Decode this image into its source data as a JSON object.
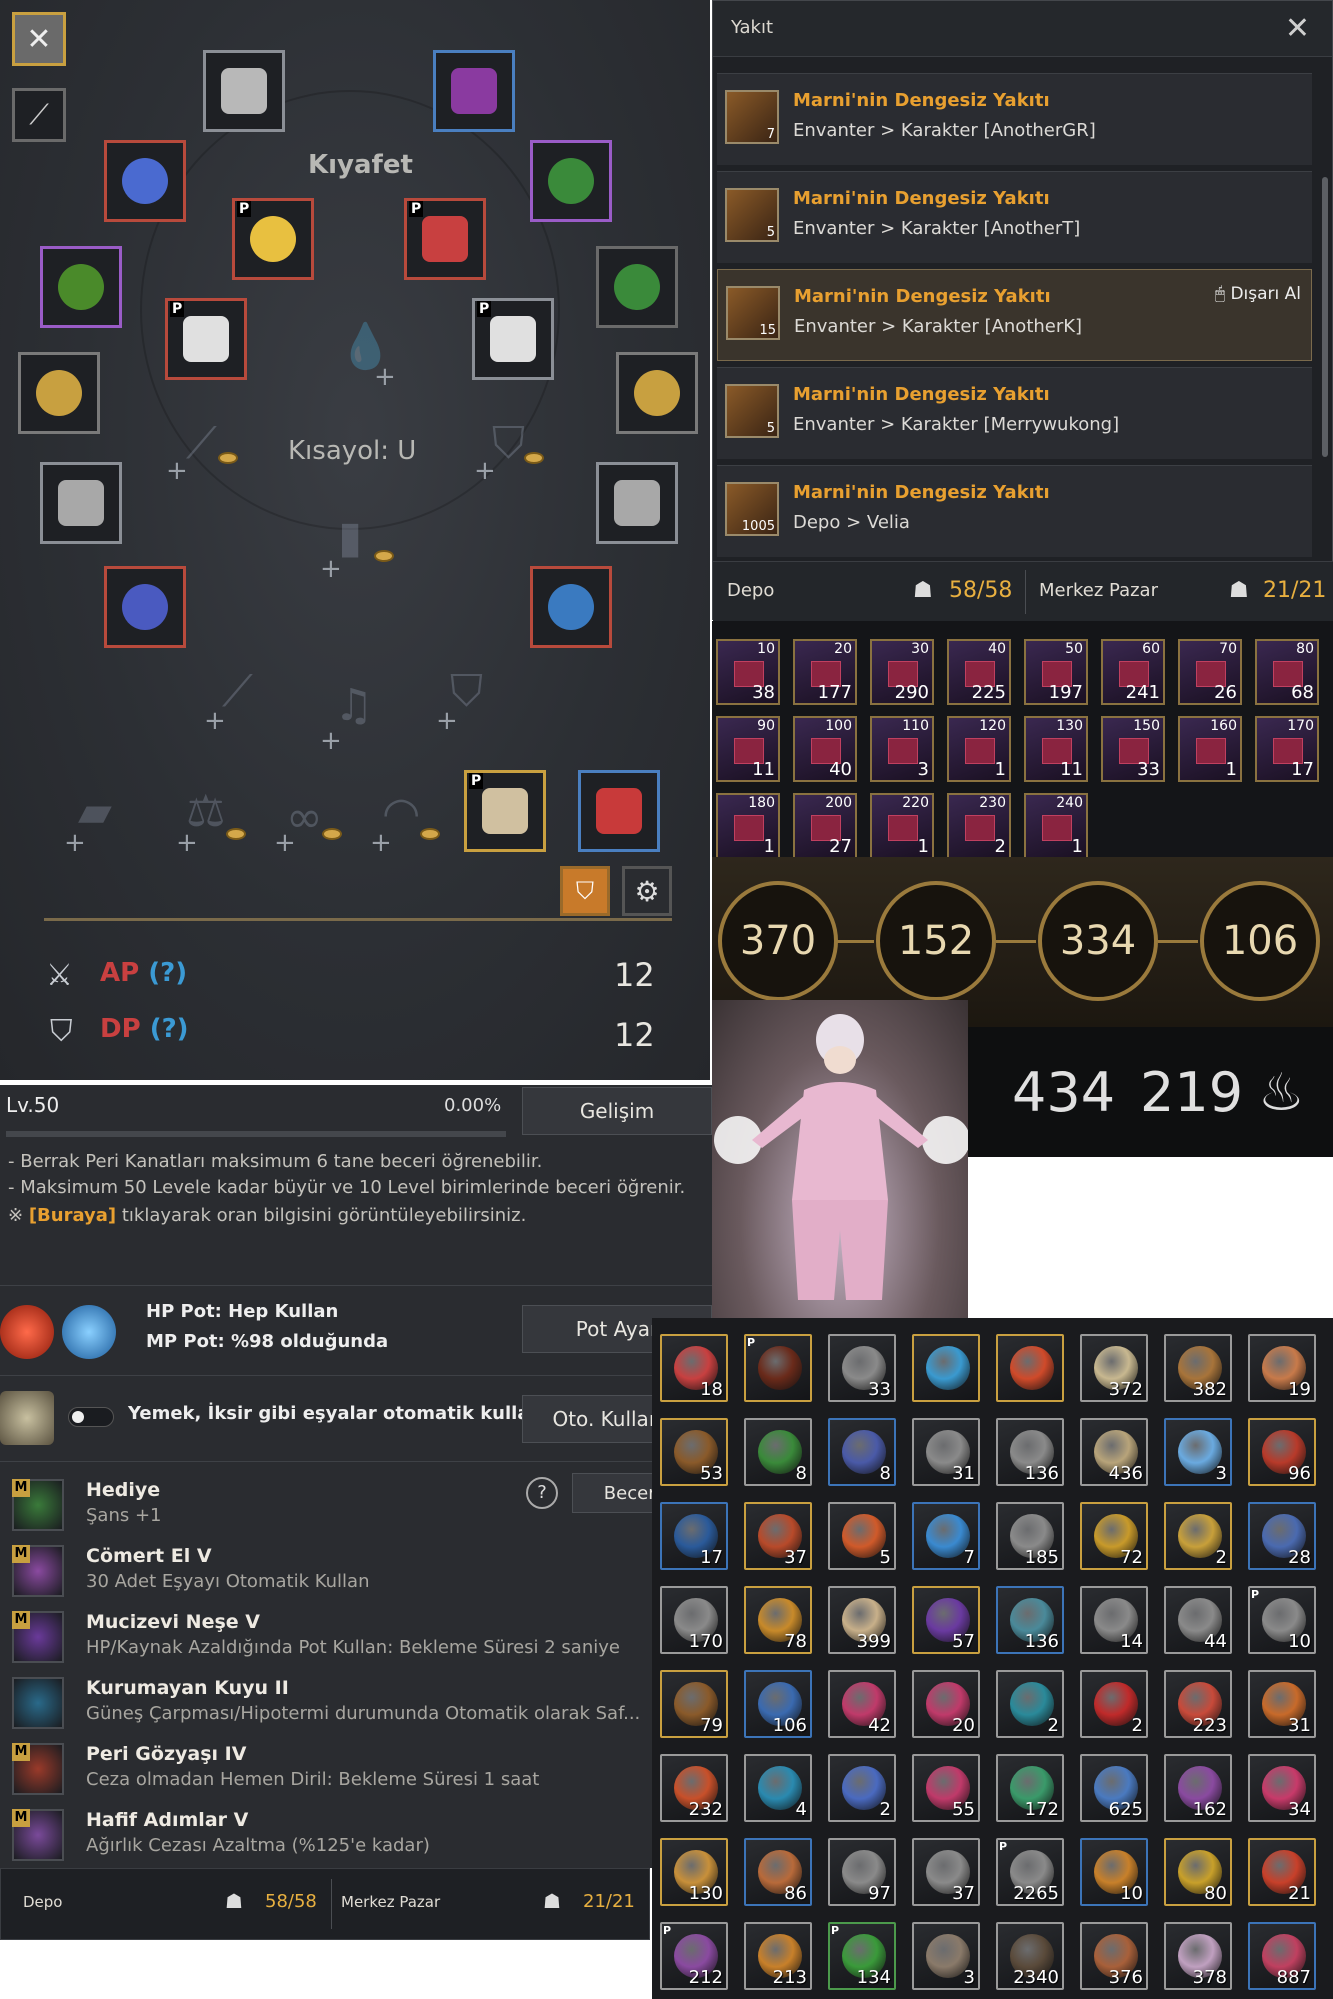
{
  "equipment": {
    "title": "Kıyafet",
    "shortcut": "Kısayol: U",
    "ap_label": "AP",
    "dp_label": "DP",
    "help_mark": "(?)",
    "ap_value": "12",
    "dp_value": "12",
    "premium_mark": "P",
    "colors": {
      "accent_gold": "#d4a84a",
      "rare_red": "#b84a3c",
      "epic_purple": "#9a5cc7",
      "blue": "#4a7fc0"
    }
  },
  "fuel": {
    "title": "Yakıt",
    "take_out": "Dışarı Al",
    "items": [
      {
        "name": "Marni'nin Dengesiz Yakıtı",
        "location": "Envanter > Karakter [AnotherGR]",
        "count": "7"
      },
      {
        "name": "Marni'nin Dengesiz Yakıtı",
        "location": "Envanter > Karakter [AnotherT]",
        "count": "5"
      },
      {
        "name": "Marni'nin Dengesiz Yakıtı",
        "location": "Envanter > Karakter [AnotherK]",
        "count": "15"
      },
      {
        "name": "Marni'nin Dengesiz Yakıtı",
        "location": "Envanter > Karakter [Merrywukong]",
        "count": "5"
      },
      {
        "name": "Marni'nin Dengesiz Yakıtı",
        "location": "Depo > Velia",
        "count": "1005"
      }
    ],
    "storage_label": "Depo",
    "storage_value": "58/58",
    "market_label": "Merkez Pazar",
    "market_value": "21/21"
  },
  "books": [
    {
      "level": "10",
      "count": "38"
    },
    {
      "level": "20",
      "count": "177"
    },
    {
      "level": "30",
      "count": "290"
    },
    {
      "level": "40",
      "count": "225"
    },
    {
      "level": "50",
      "count": "197"
    },
    {
      "level": "60",
      "count": "241"
    },
    {
      "level": "70",
      "count": "26"
    },
    {
      "level": "80",
      "count": "68"
    },
    {
      "level": "90",
      "count": "11"
    },
    {
      "level": "100",
      "count": "40"
    },
    {
      "level": "110",
      "count": "3"
    },
    {
      "level": "120",
      "count": "1"
    },
    {
      "level": "130",
      "count": "11"
    },
    {
      "level": "150",
      "count": "33"
    },
    {
      "level": "160",
      "count": "1"
    },
    {
      "level": "170",
      "count": "17"
    },
    {
      "level": "180",
      "count": "1"
    },
    {
      "level": "200",
      "count": "27"
    },
    {
      "level": "220",
      "count": "1"
    },
    {
      "level": "230",
      "count": "2"
    },
    {
      "level": "240",
      "count": "1"
    }
  ],
  "circles": [
    "370",
    "152",
    "334",
    "106"
  ],
  "strip": {
    "value1": "434",
    "value2": "219"
  },
  "skills_panel": {
    "level": "Lv.50",
    "xp_percent": "0.00%",
    "xp_fraction": 0.0,
    "growth_button": "Gelişim",
    "info_lines": [
      "- Berrak Peri Kanatları maksimum 6 tane beceri öğrenebilir.",
      "- Maksimum 50 Levele kadar büyür ve 10 Level birimlerinde beceri öğrenir."
    ],
    "info_note_prefix": "※ ",
    "info_link": "[Buraya]",
    "info_note_suffix": " tıklayarak oran bilgisini görüntüleyebilirsiniz.",
    "hp_pot": "HP Pot: Hep Kullan",
    "mp_pot": "MP Pot: %98 olduğunda",
    "pot_button": "Pot Ayar",
    "auto_use_text": "Yemek, İksir gibi eşyalar otomatik kullanılır.",
    "auto_use_button": "Oto. Kullan A",
    "skill_button": "Beceri D",
    "help_symbol": "?",
    "skills": [
      {
        "name": "Hediye",
        "desc": "Şans +1",
        "mark": "M"
      },
      {
        "name": "Cömert El V",
        "desc": "30 Adet Eşyayı Otomatik Kullan",
        "mark": "M"
      },
      {
        "name": "Mucizevi Neşe V",
        "desc": "HP/Kaynak Azaldığında Pot Kullan: Bekleme Süresi 2 saniye",
        "mark": "M"
      },
      {
        "name": "Kurumayan Kuyu II",
        "desc": "Güneş Çarpması/Hipotermi durumunda Otomatik olarak Saf...",
        "mark": ""
      },
      {
        "name": "Peri Gözyaşı IV",
        "desc": "Ceza olmadan Hemen Diril: Bekleme Süresi 1 saat",
        "mark": "M"
      },
      {
        "name": "Hafif Adımlar V",
        "desc": "Ağırlık Cezası Azaltma (%125'e kadar)",
        "mark": "M"
      }
    ]
  },
  "bottom_bar": {
    "storage_label": "Depo",
    "storage_value": "58/58",
    "market_label": "Merkez Pazar",
    "market_value": "21/21"
  },
  "inventory": [
    {
      "count": "18",
      "c": "#c84040",
      "b": "g"
    },
    {
      "count": "",
      "c": "#6a2a1a",
      "b": "g",
      "p": "P"
    },
    {
      "count": "33",
      "c": "#8a8a8a",
      "b": "w"
    },
    {
      "count": "",
      "c": "#3a9ad0",
      "b": "g"
    },
    {
      "count": "",
      "c": "#d04a2a",
      "b": "g"
    },
    {
      "count": "372",
      "c": "#c8b890",
      "b": "w"
    },
    {
      "count": "382",
      "c": "#a8743a",
      "b": "w"
    },
    {
      "count": "19",
      "c": "#c87a4a",
      "b": "w"
    },
    {
      "count": "53",
      "c": "#8a5a2a",
      "b": "g"
    },
    {
      "count": "8",
      "c": "#3a8a3a",
      "b": "w"
    },
    {
      "count": "8",
      "c": "#4a5aa8",
      "b": "b"
    },
    {
      "count": "31",
      "c": "#8a8a8a",
      "b": "w"
    },
    {
      "count": "136",
      "c": "#8a8a8a",
      "b": "w"
    },
    {
      "count": "436",
      "c": "#b8a47a",
      "b": "w"
    },
    {
      "count": "3",
      "c": "#6aaae0",
      "b": "b"
    },
    {
      "count": "96",
      "c": "#b83a2a",
      "b": "g"
    },
    {
      "count": "17",
      "c": "#2a5a9a",
      "b": "b"
    },
    {
      "count": "37",
      "c": "#b84a2a",
      "b": "g"
    },
    {
      "count": "5",
      "c": "#d05a2a",
      "b": "w"
    },
    {
      "count": "7",
      "c": "#3a8ad0",
      "b": "b"
    },
    {
      "count": "185",
      "c": "#8a8a8a",
      "b": "w"
    },
    {
      "count": "72",
      "c": "#c89a2a",
      "b": "g"
    },
    {
      "count": "2",
      "c": "#c8a03a",
      "b": "g"
    },
    {
      "count": "28",
      "c": "#4a6ab0",
      "b": "b"
    },
    {
      "count": "170",
      "c": "#8a8a8a",
      "b": "w"
    },
    {
      "count": "78",
      "c": "#c88a2a",
      "b": "g"
    },
    {
      "count": "399",
      "c": "#c8b08a",
      "b": "w"
    },
    {
      "count": "57",
      "c": "#6a3aa0",
      "b": "g"
    },
    {
      "count": "136",
      "c": "#4a8a9a",
      "b": "b"
    },
    {
      "count": "14",
      "c": "#8a8a8a",
      "b": "w"
    },
    {
      "count": "44",
      "c": "#8a8a8a",
      "b": "w"
    },
    {
      "count": "10",
      "c": "#8a8a8a",
      "b": "w",
      "p": "P"
    },
    {
      "count": "79",
      "c": "#8a5a2a",
      "b": "g"
    },
    {
      "count": "106",
      "c": "#3a6ab0",
      "b": "b"
    },
    {
      "count": "42",
      "c": "#c03a6a",
      "b": "w"
    },
    {
      "count": "20",
      "c": "#c03a6a",
      "b": "w"
    },
    {
      "count": "2",
      "c": "#2a8a9a",
      "b": "w"
    },
    {
      "count": "2",
      "c": "#c02a2a",
      "b": "w"
    },
    {
      "count": "223",
      "c": "#c84a3a",
      "b": "w"
    },
    {
      "count": "31",
      "c": "#c86a2a",
      "b": "w"
    },
    {
      "count": "232",
      "c": "#c8502a",
      "b": "w"
    },
    {
      "count": "4",
      "c": "#2a8ab0",
      "b": "w"
    },
    {
      "count": "2",
      "c": "#4a6ac0",
      "b": "w"
    },
    {
      "count": "55",
      "c": "#c03a6a",
      "b": "w"
    },
    {
      "count": "172",
      "c": "#3a9a6a",
      "b": "w"
    },
    {
      "count": "625",
      "c": "#4a7ac0",
      "b": "w"
    },
    {
      "count": "162",
      "c": "#8a4aa0",
      "b": "w"
    },
    {
      "count": "34",
      "c": "#c83a6a",
      "b": "w"
    },
    {
      "count": "130",
      "c": "#c8903a",
      "b": "g"
    },
    {
      "count": "86",
      "c": "#b86a3a",
      "b": "b"
    },
    {
      "count": "97",
      "c": "#8a8a8a",
      "b": "w"
    },
    {
      "count": "37",
      "c": "#8a8a8a",
      "b": "w"
    },
    {
      "count": "2265",
      "c": "#8a8a8a",
      "b": "w",
      "p": "P"
    },
    {
      "count": "10",
      "c": "#c8802a",
      "b": "b"
    },
    {
      "count": "80",
      "c": "#c8a02a",
      "b": "g"
    },
    {
      "count": "21",
      "c": "#c8402a",
      "b": "g"
    },
    {
      "count": "212",
      "c": "#8a4aa0",
      "b": "w",
      "p": "P"
    },
    {
      "count": "213",
      "c": "#c8802a",
      "b": "w"
    },
    {
      "count": "134",
      "c": "#3a9a3a",
      "b": "gr",
      "p": "P"
    },
    {
      "count": "3",
      "c": "#8a7a6a",
      "b": "w"
    },
    {
      "count": "2340",
      "c": "#5a4a3a",
      "b": "w"
    },
    {
      "count": "376",
      "c": "#a8603a",
      "b": "w"
    },
    {
      "count": "378",
      "c": "#c0a0c0",
      "b": "w"
    },
    {
      "count": "887",
      "c": "#c04060",
      "b": "b"
    }
  ]
}
